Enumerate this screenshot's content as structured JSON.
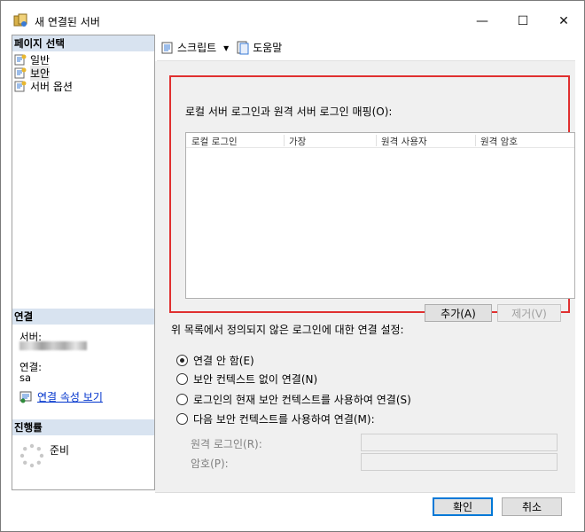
{
  "window": {
    "title": "새 연결된 서버",
    "min_symbol": "—",
    "max_symbol": "☐",
    "close_symbol": "✕"
  },
  "left_pane": {
    "page_select_header": "페이지 선택",
    "nav_items": [
      "일반",
      "보안",
      "서버 옵션"
    ],
    "selected_item": "보안",
    "connection_header": "연결",
    "server_label": "서버:",
    "connection_label": "연결:",
    "connection_value": "sa",
    "view_conn_props_link": "연결 속성 보기",
    "progress_header": "진행률",
    "progress_status": "준비"
  },
  "toolbar": {
    "script_label": "스크립트",
    "help_label": "도움말",
    "dropdown_symbol": "▾"
  },
  "mapping": {
    "title": "로컬 서버 로그인과 원격 서버 로그인 매핑(O):",
    "columns": [
      "로컬 로그인",
      "가장",
      "원격 사용자",
      "원격 암호"
    ],
    "add_button": "추가(A)",
    "remove_button": "제거(V)"
  },
  "undefined_logins": {
    "title": "위 목록에서 정의되지 않은 로그인에 대한 연결 설정:",
    "options": [
      "연결 안 함(E)",
      "보안 컨텍스트 없이 연결(N)",
      "로그인의 현재 보안 컨텍스트를 사용하여 연결(S)",
      "다음 보안 컨텍스트를 사용하여 연결(M):"
    ],
    "selected_option": "연결 안 함(E)",
    "remote_login_label": "원격 로그인(R):",
    "remote_login_value": "",
    "password_label": "암호(P):",
    "password_value": ""
  },
  "footer": {
    "ok_button": "확인",
    "cancel_button": "취소"
  },
  "colors": {
    "highlight_frame": "#e03030",
    "pane_header_bg": "#d8e3f0",
    "link": "#0033cc"
  }
}
